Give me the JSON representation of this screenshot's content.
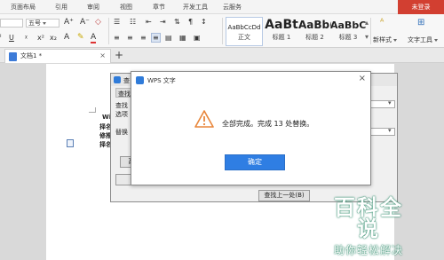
{
  "ribbon": {
    "tabs": [
      "页面布局",
      "引用",
      "审阅",
      "视图",
      "章节",
      "开发工具",
      "云服务"
    ],
    "login": "未登录",
    "font_size": "五号",
    "styles": [
      {
        "preview": "AaBbCcDd",
        "name": "正文"
      },
      {
        "preview": "AaBt",
        "name": "标题 1"
      },
      {
        "preview": "AaBb(",
        "name": "标题 2"
      },
      {
        "preview": "AaBbC",
        "name": "标题 3"
      }
    ],
    "new_style": "新样式",
    "text_tools": "文字工具"
  },
  "doc_tabs": {
    "active": "文档1 *",
    "close": "×",
    "add": "+"
  },
  "page_text": [
    "Wi",
    "择名",
    "修推",
    "择名"
  ],
  "find_dialog": {
    "title": "查",
    "tab_label": "查找",
    "find_label": "查找",
    "options_label": "选项",
    "replace_label": "替换",
    "advanced_btn": "高",
    "replace_btn": "替",
    "find_prev_btn": "查找上一处(B)"
  },
  "message_dialog": {
    "title": "WPS 文字",
    "close": "×",
    "message": "全部完成。完成 13 处替换。",
    "ok": "确定"
  },
  "watermark": {
    "title": "百科全说",
    "subtitle": "助你轻松解决"
  },
  "colors": {
    "accent": "#2f7ee3",
    "login_red": "#d23f31",
    "warning_orange": "#e8863b"
  }
}
